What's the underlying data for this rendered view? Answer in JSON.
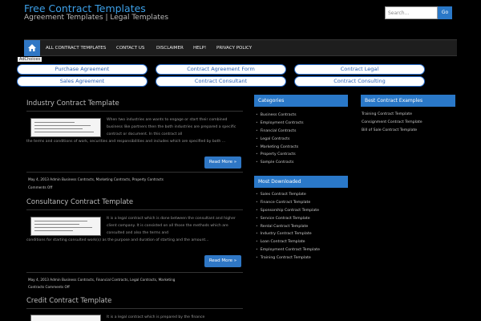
{
  "site": {
    "title": "Free Contract Templates",
    "description": "Agreement Templates | Legal Templates"
  },
  "search": {
    "placeholder": "Search...",
    "button": "Go"
  },
  "nav": {
    "home_icon": "home-icon",
    "items": [
      "ALL CONTRACT TEMPLATES",
      "CONTACT US",
      "DISCLAIMER",
      "HELP!",
      "PRIVACY POLICY"
    ]
  },
  "adchoices": "AdChoices",
  "ad_links": [
    "Purchase Agreement",
    "Contract Agreement Form",
    "Contract Legal",
    "Sales Agreement",
    "Contract Consultant",
    "Contract Consulting"
  ],
  "posts": [
    {
      "title": "Industry Contract Template",
      "excerpt": "When two industries are wants to engage or start their combined business like partners then the both industries are prepared a specific contract or document. In this contract all",
      "excerpt_full": "the terms and conditions of work, securities and responsibilities and includes which are specified by both ...",
      "read_more": "Read More »",
      "meta1": "May 4, 2013   Admin   Business Contracts, Marketing Contracts, Property Contracts",
      "meta2": "Comments Off"
    },
    {
      "title": "Consultancy Contract Template",
      "excerpt": "It is a legal contract which is done between the consultant and higher client company. It is consisted on all those the methods which are consulted and also the terms and",
      "excerpt_full": "conditions for starting consulted work(s) as the purpose and duration of starting and the amount...",
      "read_more": "Read More »",
      "meta1": "May 4, 2013   Admin   Business Contracts, Financial Contracts, Legal Contracts, Marketing",
      "meta2": "Contracts   Comments Off"
    },
    {
      "title": "Credit Contract Template",
      "excerpt": "It is a legal contract which is prepared by the finance"
    }
  ],
  "widgets": {
    "categories": {
      "title": "Categories",
      "items": [
        "Business Contracts",
        "Employment Contracts",
        "Financial Contracts",
        "Legal Contracts",
        "Marketing Contracts",
        "Property Contracts",
        "Sample Contracts"
      ]
    },
    "most_downloaded": {
      "title": "Most Downloaded",
      "items": [
        "Sales Contract Template",
        "Finance Contract Template",
        "Sponsorship Contract Template",
        "Service Contract Template",
        "Rental Contract Template",
        "Industry Contract Template",
        "Loan Contract Template",
        "Employment Contract Template",
        "Training Contract Template"
      ]
    },
    "best": {
      "title": "Best Contract Examples",
      "items": [
        "Training Contract Template",
        "Consignment Contract Template",
        "Bill of Sale Contract Template"
      ]
    }
  },
  "colors": {
    "accent": "#2a78c8",
    "background": "#000000",
    "title_blue": "#3da0e8"
  }
}
